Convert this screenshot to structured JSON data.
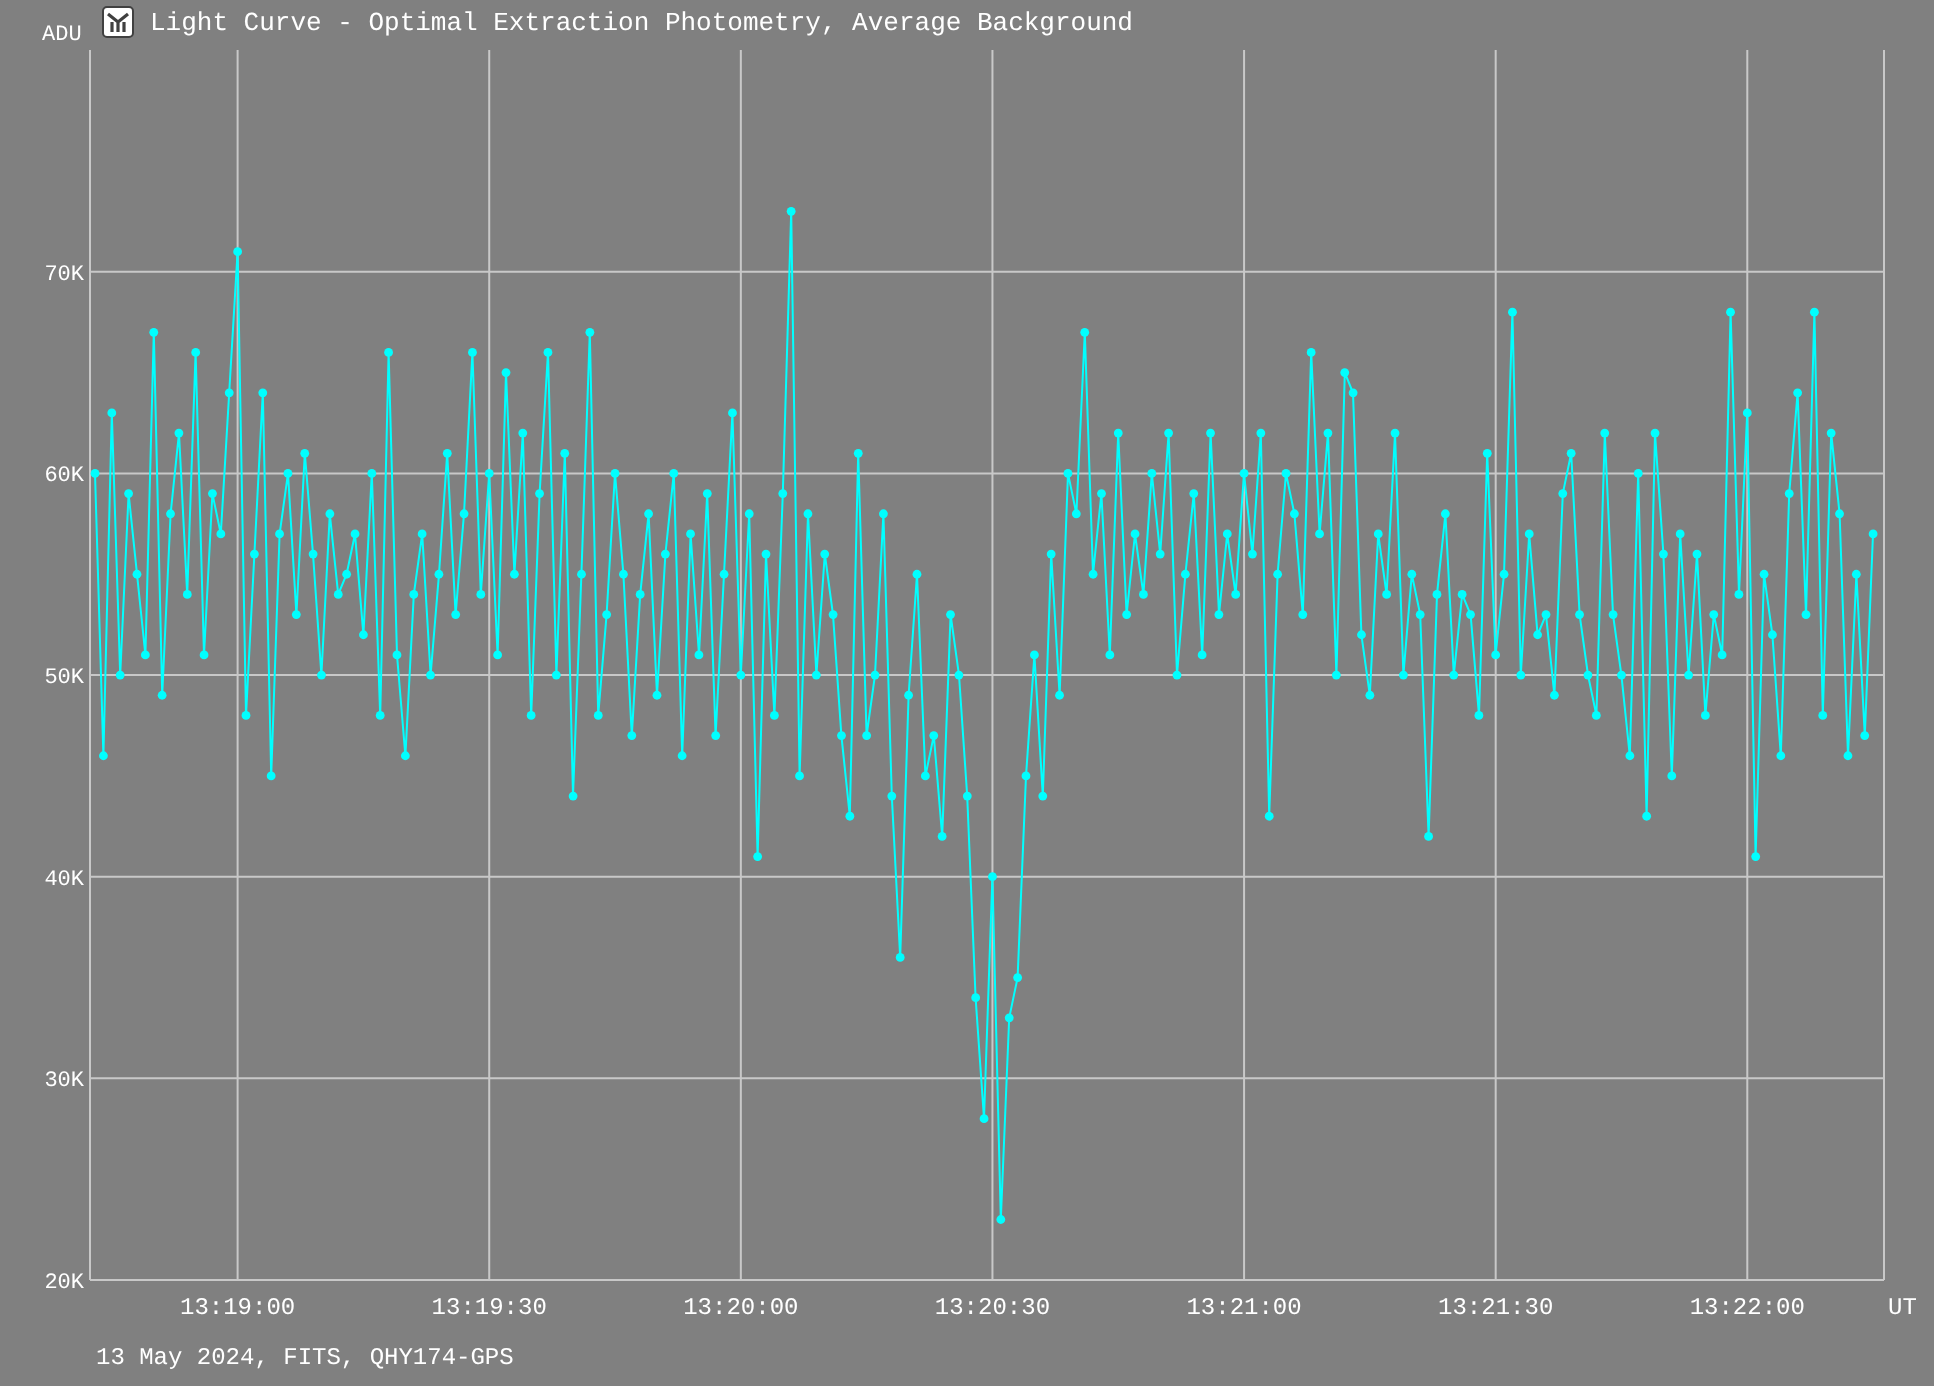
{
  "window": {
    "title": "Light Curve - Optimal Extraction Photometry, Average Background"
  },
  "chart": {
    "chart_data": {
      "type": "line",
      "xlabel": "UT",
      "ylabel": "ADU",
      "xlim": [
        47922.4,
        48136.3
      ],
      "grid": true,
      "ylim": [
        20,
        81
      ],
      "xticks": [
        {
          "value": 47940,
          "label": "13:19:00"
        },
        {
          "value": 47970,
          "label": "13:19:30"
        },
        {
          "value": 48000,
          "label": "13:20:00"
        },
        {
          "value": 48030,
          "label": "13:20:30"
        },
        {
          "value": 48060,
          "label": "13:21:00"
        },
        {
          "value": 48090,
          "label": "13:21:30"
        },
        {
          "value": 48120,
          "label": "13:22:00"
        }
      ],
      "yticks": [
        {
          "value": 20,
          "label": "20K"
        },
        {
          "value": 30,
          "label": "30K"
        },
        {
          "value": 40,
          "label": "40K"
        },
        {
          "value": 50,
          "label": "50K"
        },
        {
          "value": 60,
          "label": "60K"
        },
        {
          "value": 70,
          "label": "70K"
        }
      ],
      "x": [
        47923,
        47924,
        47925,
        47926,
        47927,
        47928,
        47929,
        47930,
        47931,
        47932,
        47933,
        47934,
        47935,
        47936,
        47937,
        47938,
        47939,
        47940,
        47941,
        47942,
        47943,
        47944,
        47945,
        47946,
        47947,
        47948,
        47949,
        47950,
        47951,
        47952,
        47953,
        47954,
        47955,
        47956,
        47957,
        47958,
        47959,
        47960,
        47961,
        47962,
        47963,
        47964,
        47965,
        47966,
        47967,
        47968,
        47969,
        47970,
        47971,
        47972,
        47973,
        47974,
        47975,
        47976,
        47977,
        47978,
        47979,
        47980,
        47981,
        47982,
        47983,
        47984,
        47985,
        47986,
        47987,
        47988,
        47989,
        47990,
        47991,
        47992,
        47993,
        47994,
        47995,
        47996,
        47997,
        47998,
        47999,
        48000,
        48001,
        48002,
        48003,
        48004,
        48005,
        48006,
        48007,
        48008,
        48009,
        48010,
        48011,
        48012,
        48013,
        48014,
        48015,
        48016,
        48017,
        48018,
        48019,
        48020,
        48021,
        48022,
        48023,
        48024,
        48025,
        48026,
        48027,
        48028,
        48029,
        48030,
        48031,
        48032,
        48033,
        48034,
        48035,
        48036,
        48037,
        48038,
        48039,
        48040,
        48041,
        48042,
        48043,
        48044,
        48045,
        48046,
        48047,
        48048,
        48049,
        48050,
        48051,
        48052,
        48053,
        48054,
        48055,
        48056,
        48057,
        48058,
        48059,
        48060,
        48061,
        48062,
        48063,
        48064,
        48065,
        48066,
        48067,
        48068,
        48069,
        48070,
        48071,
        48072,
        48073,
        48074,
        48075,
        48076,
        48077,
        48078,
        48079,
        48080,
        48081,
        48082,
        48083,
        48084,
        48085,
        48086,
        48087,
        48088,
        48089,
        48090,
        48091,
        48092,
        48093,
        48094,
        48095,
        48096,
        48097,
        48098,
        48099,
        48100,
        48101,
        48102,
        48103,
        48104,
        48105,
        48106,
        48107,
        48108,
        48109,
        48110,
        48111,
        48112,
        48113,
        48114,
        48115,
        48116,
        48117,
        48118,
        48119,
        48120,
        48121,
        48122,
        48123,
        48124,
        48125,
        48126,
        48127,
        48128,
        48129,
        48130,
        48131,
        48132,
        48133,
        48134,
        48135
      ],
      "series": [
        {
          "color": "#00ffff",
          "marker": "circle",
          "values": [
            60,
            46,
            63,
            50,
            59,
            55,
            51,
            67,
            49,
            58,
            62,
            54,
            66,
            51,
            59,
            57,
            64,
            71,
            48,
            56,
            64,
            45,
            57,
            60,
            53,
            61,
            56,
            50,
            58,
            54,
            55,
            57,
            52,
            60,
            48,
            66,
            51,
            46,
            54,
            57,
            50,
            55,
            61,
            53,
            58,
            66,
            54,
            60,
            51,
            65,
            55,
            62,
            48,
            59,
            66,
            50,
            61,
            44,
            55,
            67,
            48,
            53,
            60,
            55,
            47,
            54,
            58,
            49,
            56,
            60,
            46,
            57,
            51,
            59,
            47,
            55,
            63,
            50,
            58,
            41,
            56,
            48,
            59,
            73,
            45,
            58,
            50,
            56,
            53,
            47,
            43,
            61,
            47,
            50,
            58,
            44,
            36,
            49,
            55,
            45,
            47,
            42,
            53,
            50,
            44,
            34,
            28,
            40,
            23,
            33,
            35,
            45,
            51,
            44,
            56,
            49,
            60,
            58,
            67,
            55,
            59,
            51,
            62,
            53,
            57,
            54,
            60,
            56,
            62,
            50,
            55,
            59,
            51,
            62,
            53,
            57,
            54,
            60,
            56,
            62,
            43,
            55,
            60,
            58,
            53,
            66,
            57,
            62,
            50,
            65,
            64,
            52,
            49,
            57,
            54,
            62,
            50,
            55,
            53,
            42,
            54,
            58,
            50,
            54,
            53,
            48,
            61,
            51,
            55,
            68,
            50,
            57,
            52,
            53,
            49,
            59,
            61,
            53,
            50,
            48,
            62,
            53,
            50,
            46,
            60,
            43,
            62,
            56,
            45,
            57,
            50,
            56,
            48,
            53,
            51,
            68,
            54,
            63,
            41,
            55,
            52,
            46,
            59,
            64,
            53,
            68,
            48,
            62,
            58,
            46,
            55,
            47,
            57
          ]
        }
      ]
    }
  },
  "footer": {
    "text": "13 May 2024, FITS, QHY174-GPS"
  }
}
